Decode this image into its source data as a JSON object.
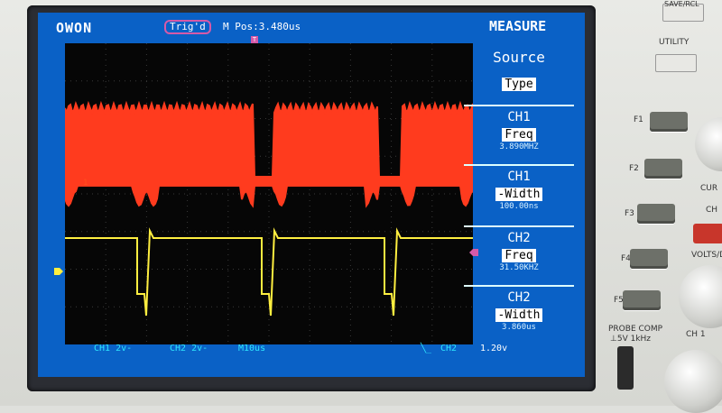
{
  "header": {
    "brand": "OWON",
    "trigger_status": "Trig'd",
    "horizontal_position": "M Pos:3.480us",
    "menu_title": "MEASURE",
    "trigger_marker": "T"
  },
  "menu": {
    "items": [
      {
        "title": "Source",
        "value": "Type",
        "reading": ""
      },
      {
        "title": "CH1",
        "value": "Freq",
        "reading": "3.890MHZ"
      },
      {
        "title": "CH1",
        "value": "-Width",
        "reading": "100.00ns"
      },
      {
        "title": "CH2",
        "value": "Freq",
        "reading": "31.50KHZ"
      },
      {
        "title": "CH2",
        "value": "-Width",
        "reading": "3.860us"
      }
    ]
  },
  "status_bar": {
    "ch1_scale": "CH1  2v-",
    "ch2_scale": "CH2  2v-",
    "timebase": "M10us",
    "trigger_source": "CH2",
    "trigger_level": "1.20v"
  },
  "markers": {
    "ch1": "1"
  },
  "panel": {
    "save_recall_label": "SAVE/RCL",
    "utility_label": "UTILITY",
    "f_buttons": [
      "F1",
      "F2",
      "F3",
      "F4",
      "F5"
    ],
    "probe_comp_label": "PROBE COMP",
    "probe_comp_spec": "⊥5V 1kHz",
    "cursor_label": "CUR",
    "math_label": "CH",
    "volts_label": "VOLTS/D",
    "ch_knob_label": "CH 1"
  },
  "colors": {
    "screen_bg": "#0a61c6",
    "ch1": "#ff3b1e",
    "ch2": "#ffef40",
    "status_text": "#2ee6ff",
    "trigger": "#d65aa8"
  }
}
